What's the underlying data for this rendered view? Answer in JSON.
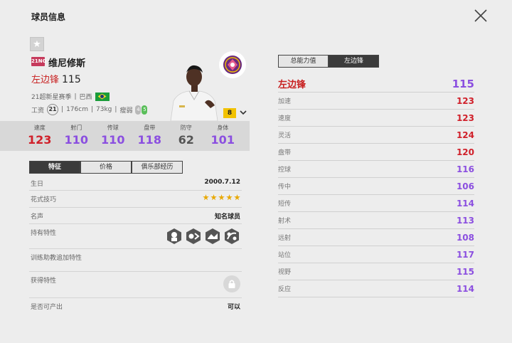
{
  "header": {
    "title": "球员信息"
  },
  "player": {
    "season_badge": "21NG",
    "name": "维尼修斯",
    "position": "左边锋",
    "overall": "115",
    "season_name": "21超新星赛季",
    "nation": "巴西",
    "wage_label": "工资",
    "wage": "21",
    "height": "176cm",
    "weight": "73kg",
    "body": "瘦弱",
    "weak_foot": "4",
    "strong_foot": "5",
    "enhance": "8"
  },
  "stats": [
    {
      "label": "速度",
      "value": "123",
      "color": "#d0202a"
    },
    {
      "label": "射门",
      "value": "110",
      "color": "#8b4fe0"
    },
    {
      "label": "传球",
      "value": "110",
      "color": "#8b4fe0"
    },
    {
      "label": "盘带",
      "value": "118",
      "color": "#8b4fe0"
    },
    {
      "label": "防守",
      "value": "62",
      "color": "#555555"
    },
    {
      "label": "身体",
      "value": "101",
      "color": "#8b4fe0"
    }
  ],
  "left_tabs": [
    "特征",
    "价格",
    "俱乐部经历"
  ],
  "info": {
    "birthday_label": "生日",
    "birthday": "2000.7.12",
    "skill_label": "花式技巧",
    "skill_stars": 5,
    "fame_label": "名声",
    "fame": "知名球员",
    "traits_label": "持有特性",
    "training_label": "训练助教追加特性",
    "acquired_label": "获得特性",
    "producible_label": "是否可产出",
    "producible": "可以"
  },
  "right_tabs": [
    "总能力值",
    "左边锋"
  ],
  "position_rating": {
    "name": "左边锋",
    "value": "115"
  },
  "attributes": [
    {
      "name": "加速",
      "value": "123",
      "color": "#d0202a"
    },
    {
      "name": "速度",
      "value": "123",
      "color": "#d0202a"
    },
    {
      "name": "灵活",
      "value": "124",
      "color": "#d0202a"
    },
    {
      "name": "盘带",
      "value": "120",
      "color": "#d0202a"
    },
    {
      "name": "控球",
      "value": "116",
      "color": "#8b4fe0"
    },
    {
      "name": "传中",
      "value": "106",
      "color": "#8b4fe0"
    },
    {
      "name": "短传",
      "value": "114",
      "color": "#8b4fe0"
    },
    {
      "name": "射术",
      "value": "113",
      "color": "#8b4fe0"
    },
    {
      "name": "远射",
      "value": "108",
      "color": "#8b4fe0"
    },
    {
      "name": "站位",
      "value": "117",
      "color": "#8b4fe0"
    },
    {
      "name": "视野",
      "value": "115",
      "color": "#8b4fe0"
    },
    {
      "name": "反应",
      "value": "114",
      "color": "#8b4fe0"
    }
  ],
  "icons": [
    "star-icon",
    "close-icon",
    "club-logo-icon",
    "chevron-down-icon",
    "trait-icon",
    "lock-icon"
  ]
}
